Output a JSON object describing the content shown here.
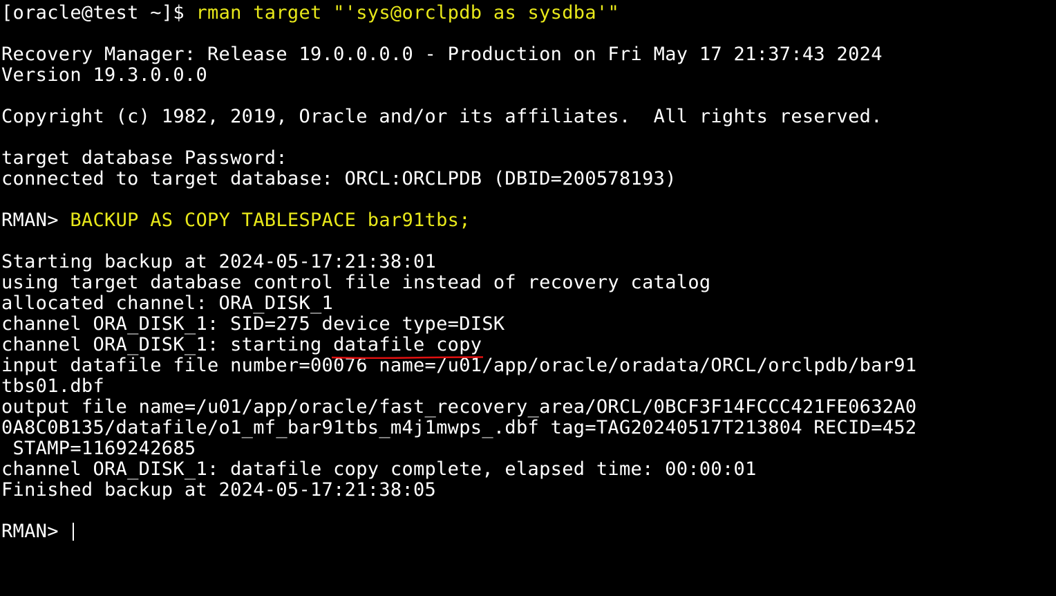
{
  "terminal": {
    "prompt1": {
      "prefix": "[oracle@test ~]$ ",
      "command": "rman target \"'sys@orclpdb as sysdba'\""
    },
    "banner": {
      "line1": "Recovery Manager: Release 19.0.0.0.0 - Production on Fri May 17 21:37:43 2024",
      "line2": "Version 19.3.0.0.0",
      "copyright": "Copyright (c) 1982, 2019, Oracle and/or its affiliates.  All rights reserved."
    },
    "auth": {
      "password_prompt": "target database Password:",
      "connected": "connected to target database: ORCL:ORCLPDB (DBID=200578193)"
    },
    "rman_command": {
      "prompt": "RMAN> ",
      "command": "BACKUP AS COPY TABLESPACE bar91tbs;"
    },
    "output": {
      "l1": "Starting backup at 2024-05-17:21:38:01",
      "l2": "using target database control file instead of recovery catalog",
      "l3": "allocated channel: ORA_DISK_1",
      "l4": "channel ORA_DISK_1: SID=275 device type=DISK",
      "l5_prefix": "channel ORA_DISK_1: starting ",
      "l5_highlight": "datafile copy",
      "l6": "input datafile file number=00076 name=/u01/app/oracle/oradata/ORCL/orclpdb/bar91",
      "l7": "tbs01.dbf",
      "l8": "output file name=/u01/app/oracle/fast_recovery_area/ORCL/0BCF3F14FCCC421FE0632A0",
      "l9": "0A8C0B135/datafile/o1_mf_bar91tbs_m4j1mwps_.dbf tag=TAG20240517T213804 RECID=452",
      "l10": " STAMP=1169242685",
      "l11": "channel ORA_DISK_1: datafile copy complete, elapsed time: 00:00:01",
      "l12": "Finished backup at 2024-05-17:21:38:05"
    },
    "final_prompt": "RMAN> "
  },
  "colors": {
    "background": "#000000",
    "text": "#ffffff",
    "command_highlight": "#e8e81a",
    "annotation_underline": "#e01010"
  }
}
